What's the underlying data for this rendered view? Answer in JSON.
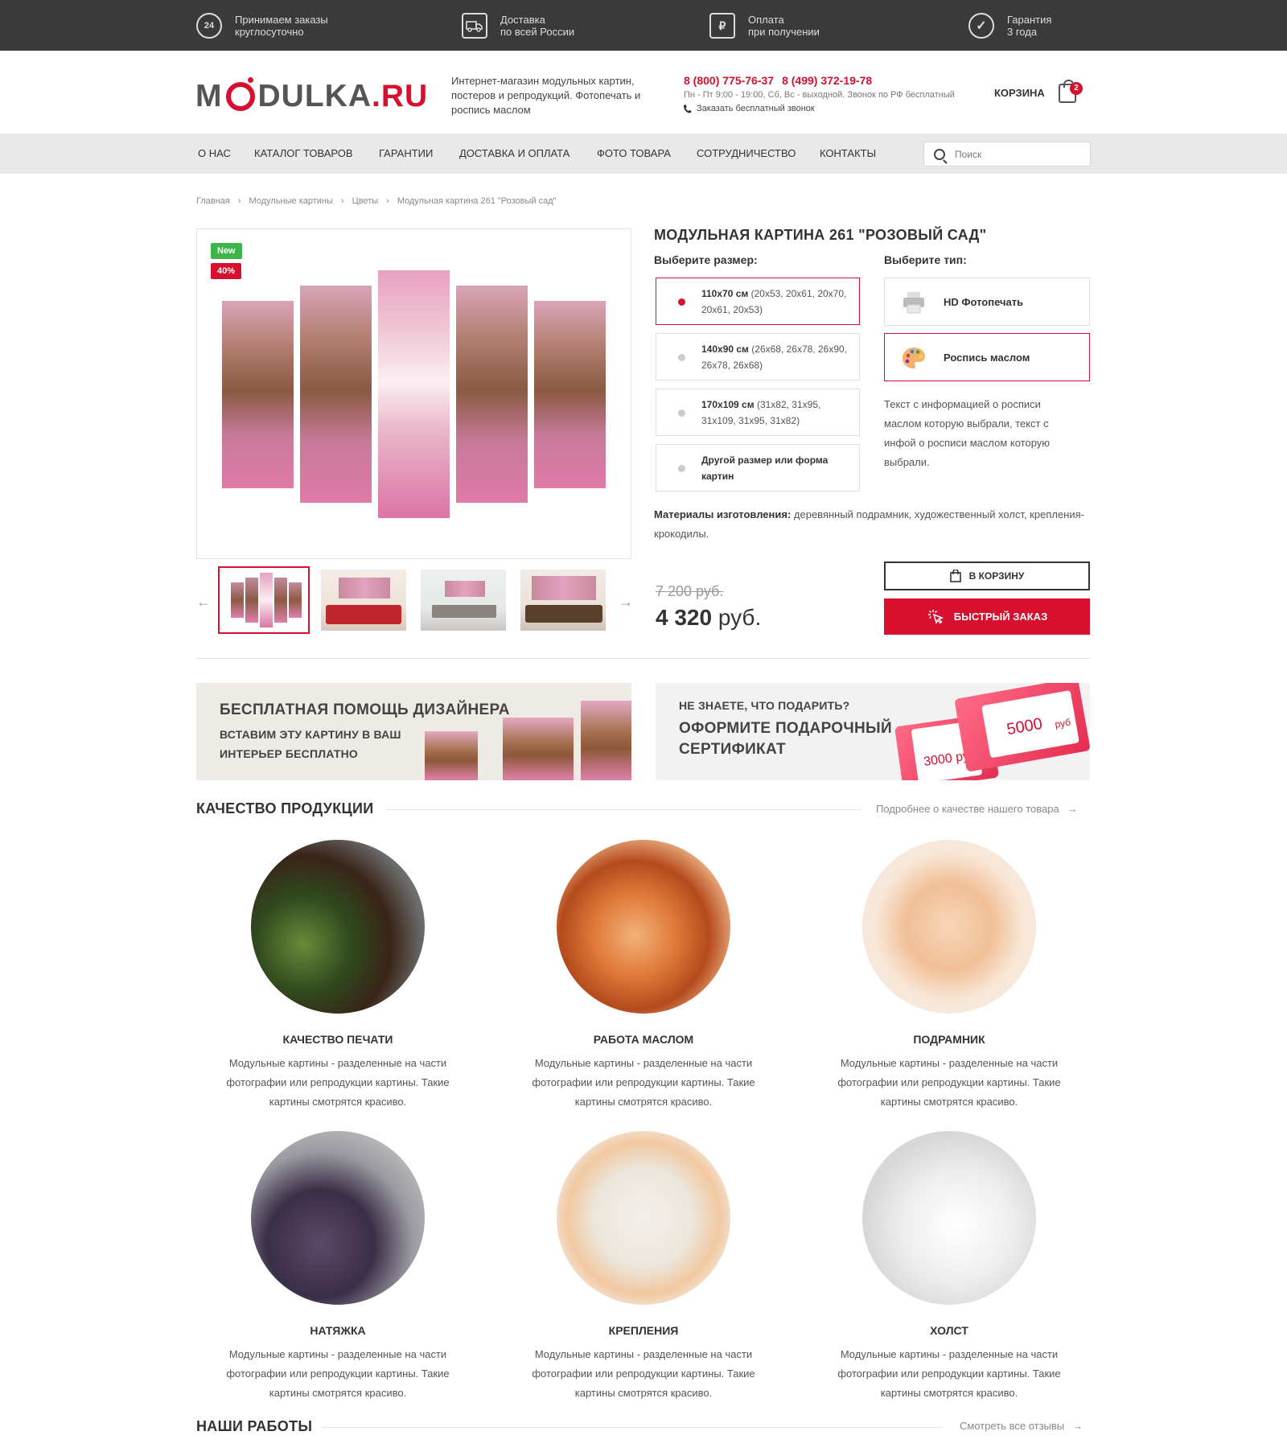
{
  "topbar": {
    "items": [
      {
        "icon": "clock-24-icon",
        "badge": "24",
        "line1": "Принимаем заказы",
        "line2": "круглосуточно"
      },
      {
        "icon": "delivery-truck-icon",
        "line1": "Доставка",
        "line2": "по всей России"
      },
      {
        "icon": "receipt-ruble-icon",
        "line1": "Оплата",
        "line2": "при получении"
      },
      {
        "icon": "checkmark-circle-icon",
        "line1": "Гарантия",
        "line2": "3 года"
      }
    ]
  },
  "header": {
    "logo_left": "M",
    "logo_right": "DULKA",
    "logo_tld": ".RU",
    "tagline": "Интернет-магазин модульных картин, постеров и репродукций. Фотопечать и роспись маслом",
    "phone1": "8 (800) 775-76-37",
    "phone2": "8 (499) 372-19-78",
    "hours": "Пн - Пт 9:00 - 19:00, Сб, Вс - выходной. Звонок по РФ бесплатный",
    "callback": "Заказать бесплатный звонок",
    "cart_label": "КОРЗИНА",
    "cart_count": "2"
  },
  "nav": {
    "items": [
      "О НАС",
      "КАТАЛОГ ТОВАРОВ",
      "ГАРАНТИИ",
      "ДОСТАВКА И ОПЛАТА",
      "ФОТО ТОВАРА",
      "СОТРУДНИЧЕСТВО",
      "КОНТАКТЫ"
    ],
    "search_placeholder": "Поиск"
  },
  "breadcrumb": [
    "Главная",
    "Модульные картины",
    "Цветы",
    "Модульная картина 261 \"Розовый сад\""
  ],
  "product": {
    "title": "МОДУЛЬНАЯ КАРТИНА 261 \"РОЗОВЫЙ САД\"",
    "badge_new": "New",
    "badge_discount": "40%",
    "size_heading": "Выберите размер:",
    "type_heading": "Выберите тип:",
    "sizes": [
      {
        "main": "110x70 см",
        "detail": " (20x53, 20x61, 20x70, 20x61, 20x53)",
        "selected": true
      },
      {
        "main": "140x90 см",
        "detail": " (26x68, 26x78, 26x90, 26x78, 26x68)",
        "selected": false
      },
      {
        "main": "170x109 см",
        "detail": " (31x82, 31x95, 31x109, 31x95, 31x82)",
        "selected": false
      },
      {
        "main": "Другой размер или форма картин",
        "detail": "",
        "selected": false
      }
    ],
    "types": [
      {
        "label": "HD Фотопечать",
        "icon": "printer-icon",
        "selected": false
      },
      {
        "label": "Роспись маслом",
        "icon": "paint-palette-icon",
        "selected": true
      }
    ],
    "type_description": "Текст с информацией о росписи маслом которую выбрали, текст с инфой о росписи маслом которую выбрали.",
    "materials_label": "Материалы изготовления:",
    "materials_text": " деревянный подрамник, художественный холст, крепления-крокодилы.",
    "old_price": "7 200 руб.",
    "price": "4 320",
    "price_currency": " руб.",
    "btn_cart": "В КОРЗИНУ",
    "btn_fast": "БЫСТРЫЙ ЗАКАЗ"
  },
  "promos": {
    "left_title": "БЕСПЛАТНАЯ ПОМОЩЬ ДИЗАЙНЕРА",
    "left_line1": "ВСТАВИМ ЭТУ КАРТИНУ В ВАШ",
    "left_line2": "ИНТЕРЬЕР БЕСПЛАТНО",
    "right_small": "НЕ ЗНАЕТЕ, ЧТО ПОДАРИТЬ?",
    "right_line1": "ОФОРМИТЕ ПОДАРОЧНЫЙ",
    "right_line2": "СЕРТИФИКАТ",
    "cert_amount_1": "5000",
    "cert_currency": "руб",
    "cert_amount_2": "3000 ру"
  },
  "quality": {
    "title": "КАЧЕСТВО ПРОДУКЦИИ",
    "link": "Подробнее о качестве нашего товара",
    "items": [
      {
        "title": "КАЧЕСТВО ПЕЧАТИ",
        "text": "Модульные картины - разделенные на части фотографии или репродукции картины. Такие картины смотрятся красиво."
      },
      {
        "title": "РАБОТА МАСЛОМ",
        "text": "Модульные картины - разделенные на части фотографии или репродукции картины. Такие картины смотрятся красиво."
      },
      {
        "title": "ПОДРАМНИК",
        "text": "Модульные картины - разделенные на части фотографии или репродукции картины. Такие картины смотрятся красиво."
      },
      {
        "title": "НАТЯЖКА",
        "text": "Модульные картины - разделенные на части фотографии или репродукции картины. Такие картины смотрятся красиво."
      },
      {
        "title": "КРЕПЛЕНИЯ",
        "text": "Модульные картины - разделенные на части фотографии или репродукции картины. Такие картины смотрятся красиво."
      },
      {
        "title": "ХОЛСТ",
        "text": "Модульные картины - разделенные на части фотографии или репродукции картины. Такие картины смотрятся красиво."
      }
    ]
  },
  "works": {
    "title": "НАШИ РАБОТЫ",
    "link": "Смотреть все отзывы"
  },
  "colors": {
    "accent": "#d6102e",
    "topbar": "#3a3a3a",
    "nav": "#e9e9e9",
    "badge_new": "#3db54a"
  }
}
